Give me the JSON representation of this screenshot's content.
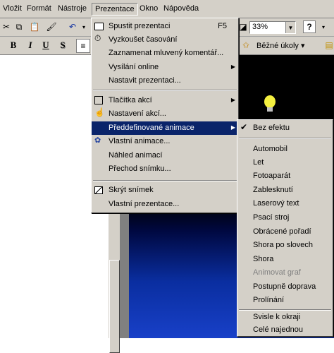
{
  "menubar": {
    "items": [
      "Vložit",
      "Formát",
      "Nástroje",
      "Prezentace",
      "Okno",
      "Nápověda"
    ],
    "active": "Prezentace"
  },
  "toolbar": {
    "zoom": "33%",
    "tasks": "Běžné úkoly",
    "format_bold": "B",
    "format_italic": "I",
    "format_underline": "U",
    "format_shadow": "S"
  },
  "presentation_menu": {
    "items": [
      {
        "label": "Spustit prezentaci",
        "shortcut": "F5"
      },
      {
        "label": "Vyzkoušet časování"
      },
      {
        "label": "Zaznamenat mluvený komentář..."
      },
      {
        "label": "Vysílání online"
      },
      {
        "label": "Nastavit prezentaci..."
      },
      {
        "label": "Tlačítka akcí"
      },
      {
        "label": "Nastavení akcí..."
      },
      {
        "label": "Předdefinované animace"
      },
      {
        "label": "Vlastní animace..."
      },
      {
        "label": "Náhled animací"
      },
      {
        "label": "Přechod snímku..."
      },
      {
        "label": "Skrýt snímek"
      },
      {
        "label": "Vlastní prezentace..."
      }
    ]
  },
  "animation_submenu": {
    "items": [
      {
        "label": "Bez efektu",
        "checked": true
      },
      {
        "label": "Automobil"
      },
      {
        "label": "Let"
      },
      {
        "label": "Fotoaparát"
      },
      {
        "label": "Zablesknutí"
      },
      {
        "label": "Laserový text"
      },
      {
        "label": "Psací stroj"
      },
      {
        "label": "Obrácené pořadí"
      },
      {
        "label": "Shora po slovech"
      },
      {
        "label": "Shora"
      },
      {
        "label": "Animovat graf",
        "disabled": true
      },
      {
        "label": "Postupně doprava"
      },
      {
        "label": "Prolínání"
      },
      {
        "label": "Svisle k okraji"
      },
      {
        "label": "Celé najednou"
      }
    ]
  }
}
